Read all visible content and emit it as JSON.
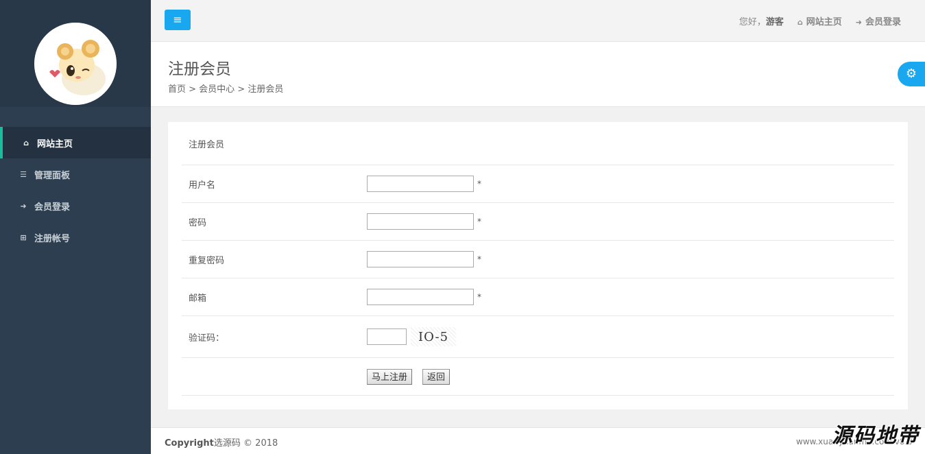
{
  "sidebar": {
    "items": [
      {
        "icon": "home-icon",
        "glyph": "⌂",
        "label": "网站主页"
      },
      {
        "icon": "list-icon",
        "glyph": "☰",
        "label": "管理面板"
      },
      {
        "icon": "sign-in-icon",
        "glyph": "➜",
        "label": "会员登录"
      },
      {
        "icon": "plus-square-icon",
        "glyph": "⊞",
        "label": "注册帐号"
      }
    ]
  },
  "topbar": {
    "menu_glyph": "≡",
    "greeting": "您好，",
    "user": "游客",
    "home_glyph": "⌂",
    "home_label": "网站主页",
    "login_glyph": "➜",
    "login_label": "会员登录"
  },
  "header": {
    "title": "注册会员",
    "breadcrumb": "首页 > 会员中心 > 注册会员",
    "gear_glyph": "⚙"
  },
  "form": {
    "title": "注册会员",
    "username_label": "用户名",
    "password_label": "密码",
    "repeat_label": "重复密码",
    "email_label": "邮箱",
    "captcha_label": "验证码：",
    "required_mark": "*",
    "captcha_text": "IO-5",
    "submit_label": "马上注册",
    "back_label": "返回",
    "username_value": "",
    "password_value": "",
    "repeat_value": "",
    "email_value": "",
    "captcha_value": ""
  },
  "footer": {
    "copyright_bold": "Copyright",
    "copyright_rest": "选源码 © 2018",
    "site": "www.xuanyuanma.com v8.0"
  },
  "watermark": "源码地带",
  "colors": {
    "accent": "#19a7f0",
    "sidebar": "#2c3e50",
    "active_border": "#1abc9c"
  }
}
